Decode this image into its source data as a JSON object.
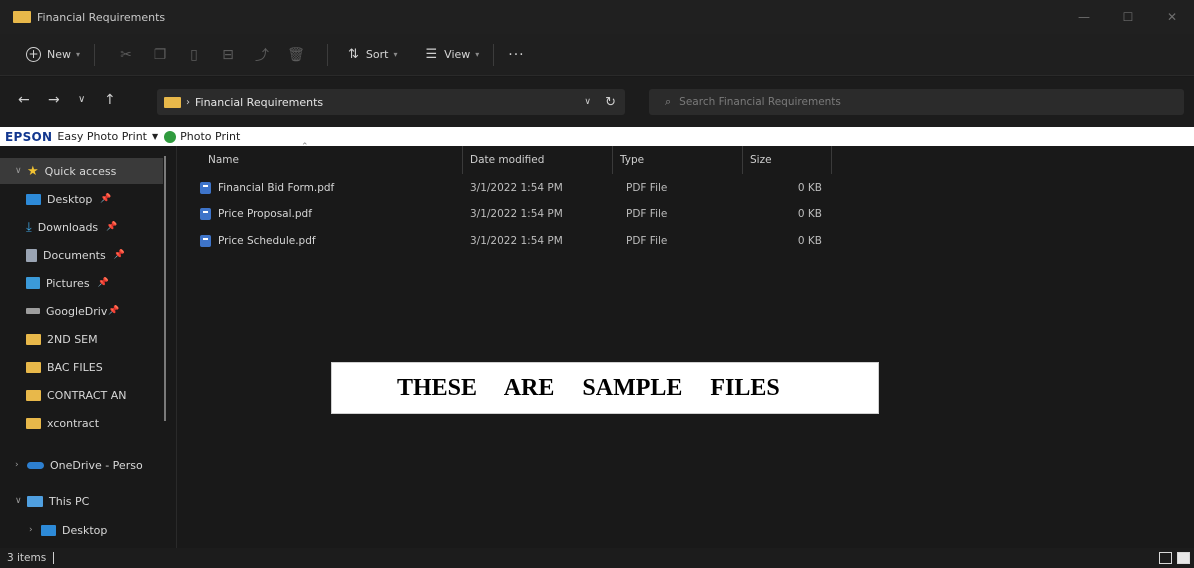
{
  "window": {
    "title": "Financial Requirements",
    "controls": {
      "minimize": "—",
      "maximize": "☐",
      "close": "✕"
    }
  },
  "commandbar": {
    "new_label": "New",
    "sort_label": "Sort",
    "view_label": "View",
    "more_label": "···",
    "icons": [
      "cut-icon",
      "copy-icon",
      "paste-icon",
      "rename-icon",
      "share-icon",
      "delete-icon"
    ]
  },
  "address": {
    "path": "Financial Requirements",
    "search_placeholder": "Search Financial Requirements"
  },
  "epson": {
    "brand": "EPSON",
    "easy_label": "Easy Photo Print",
    "photo_label": "Photo Print"
  },
  "sidebar": {
    "items": [
      {
        "label": "Quick access",
        "icon": "star-icon"
      },
      {
        "label": "Desktop",
        "icon": "desktop-folder-icon",
        "pinned": true
      },
      {
        "label": "Downloads",
        "icon": "download-icon",
        "pinned": true
      },
      {
        "label": "Documents",
        "icon": "documents-icon",
        "pinned": true
      },
      {
        "label": "Pictures",
        "icon": "pictures-icon",
        "pinned": true
      },
      {
        "label": "GoogleDriv",
        "icon": "drive-icon",
        "pinned": true
      },
      {
        "label": "2ND SEM",
        "icon": "folder-icon"
      },
      {
        "label": "BAC FILES",
        "icon": "folder-icon"
      },
      {
        "label": "CONTRACT AN",
        "icon": "folder-icon"
      },
      {
        "label": "xcontract",
        "icon": "folder-icon"
      },
      {
        "label": "OneDrive - Perso",
        "icon": "onedrive-icon"
      },
      {
        "label": "This PC",
        "icon": "pc-icon"
      },
      {
        "label": "Desktop",
        "icon": "desktop-folder-icon"
      }
    ]
  },
  "columns": {
    "name": "Name",
    "modified": "Date modified",
    "type": "Type",
    "size": "Size"
  },
  "files": [
    {
      "name": "Financial Bid Form.pdf",
      "modified": "3/1/2022 1:54 PM",
      "type": "PDF File",
      "size": "0 KB"
    },
    {
      "name": "Price Proposal.pdf",
      "modified": "3/1/2022 1:54 PM",
      "type": "PDF File",
      "size": "0 KB"
    },
    {
      "name": "Price Schedule.pdf",
      "modified": "3/1/2022 1:54 PM",
      "type": "PDF File",
      "size": "0 KB"
    }
  ],
  "overlay": {
    "text": "THESE ARE SAMPLE FILES"
  },
  "status": {
    "count": "3 items"
  },
  "colors": {
    "background": "#191919",
    "folder": "#e8b84a",
    "accent": "#2d8ad8",
    "epson_brand": "#12378f"
  }
}
